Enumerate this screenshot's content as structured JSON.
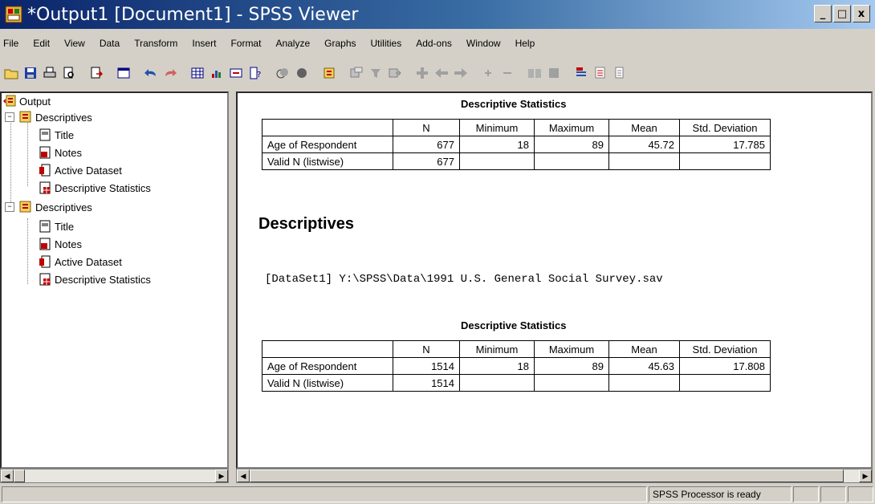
{
  "window": {
    "title": "*Output1 [Document1] - SPSS Viewer",
    "controls": [
      "_",
      "□",
      "x"
    ]
  },
  "menu": [
    "File",
    "Edit",
    "View",
    "Data",
    "Transform",
    "Insert",
    "Format",
    "Analyze",
    "Graphs",
    "Utilities",
    "Add-ons",
    "Window",
    "Help"
  ],
  "outline": {
    "root": "Output",
    "groups": [
      {
        "label": "Descriptives",
        "items": [
          "Title",
          "Notes",
          "Active Dataset",
          "Descriptive Statistics"
        ]
      },
      {
        "label": "Descriptives",
        "items": [
          "Title",
          "Notes",
          "Active Dataset",
          "Descriptive Statistics"
        ]
      }
    ]
  },
  "viewer": {
    "table1": {
      "title": "Descriptive Statistics",
      "headers": [
        "",
        "N",
        "Minimum",
        "Maximum",
        "Mean",
        "Std. Deviation"
      ],
      "rows": [
        [
          "Age of Respondent",
          "677",
          "18",
          "89",
          "45.72",
          "17.785"
        ],
        [
          "Valid N (listwise)",
          "677",
          "",
          "",
          "",
          ""
        ]
      ]
    },
    "heading": "Descriptives",
    "dataset_line": "[DataSet1] Y:\\SPSS\\Data\\1991 U.S. General Social Survey.sav",
    "table2": {
      "title": "Descriptive Statistics",
      "headers": [
        "",
        "N",
        "Minimum",
        "Maximum",
        "Mean",
        "Std. Deviation"
      ],
      "rows": [
        [
          "Age of Respondent",
          "1514",
          "18",
          "89",
          "45.63",
          "17.808"
        ],
        [
          "Valid N (listwise)",
          "1514",
          "",
          "",
          "",
          ""
        ]
      ]
    }
  },
  "status": {
    "message": "SPSS  Processor is ready"
  },
  "colors": {
    "titlebar_start": "#0a246a",
    "titlebar_end": "#a6caf0",
    "chrome": "#d4d0c8"
  }
}
